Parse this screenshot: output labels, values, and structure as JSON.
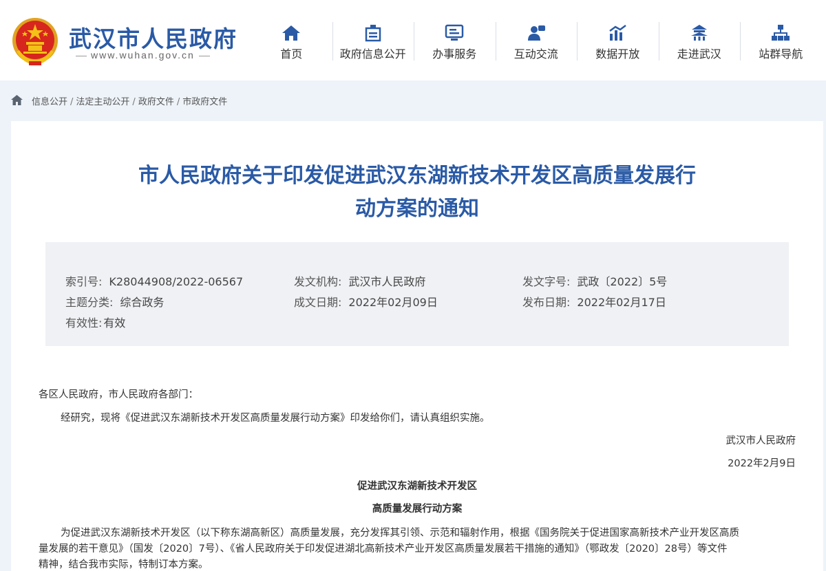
{
  "header": {
    "site_name": "武汉市人民政府",
    "site_url": "www.wuhan.gov.cn",
    "nav": [
      {
        "label": "首页",
        "icon": "home-icon"
      },
      {
        "label": "政府信息公开",
        "icon": "info-disclosure-icon"
      },
      {
        "label": "办事服务",
        "icon": "service-icon"
      },
      {
        "label": "互动交流",
        "icon": "interaction-icon"
      },
      {
        "label": "数据开放",
        "icon": "data-chart-icon"
      },
      {
        "label": "走进武汉",
        "icon": "pavilion-icon"
      },
      {
        "label": "站群导航",
        "icon": "sitemap-icon"
      }
    ],
    "colors": {
      "brand": "#2a5aa6",
      "emblem_red": "#d7261d",
      "emblem_gold": "#f3c117"
    }
  },
  "breadcrumb": [
    "信息公开",
    "法定主动公开",
    "政府文件",
    "市政府文件"
  ],
  "article": {
    "title_line1": "市人民政府关于印发促进武汉东湖新技术开发区高质量发展行",
    "title_line2": "动方案的通知",
    "meta": {
      "index_key": "索引号:",
      "index_val": "K28044908/2022-06567",
      "issuer_key": "发文机构:",
      "issuer_val": "武汉市人民政府",
      "docno_key": "发文字号:",
      "docno_val": "武政〔2022〕5号",
      "topic_key": "主题分类:",
      "topic_val": "综合政务",
      "created_key": "成文日期:",
      "created_val": "2022年02月09日",
      "published_key": "发布日期:",
      "published_val": "2022年02月17日",
      "validity_key": "有效性:",
      "validity_val": "有效"
    },
    "salutation": "各区人民政府，市人民政府各部门：",
    "para1": "经研究，现将《促进武汉东湖新技术开发区高质量发展行动方案》印发给你们，请认真组织实施。",
    "signature": "武汉市人民政府",
    "sign_date": "2022年2月9日",
    "sub_title1": "促进武汉东湖新技术开发区",
    "sub_title2": "高质量发展行动方案",
    "para2_line1": "为促进武汉东湖新技术开发区（以下称东湖高新区）高质量发展，充分发挥其引领、示范和辐射作用，根据《国务院关于促进国家高新技术产业开发区高质",
    "para2_line2": "量发展的若干意见》（国发〔2020〕7号）、《省人民政府关于印发促进湖北高新技术产业开发区高质量发展若干措施的通知》（鄂政发〔2020〕28号）等文件",
    "para2_line3": "精神，结合我市实际，特制订本方案。"
  }
}
